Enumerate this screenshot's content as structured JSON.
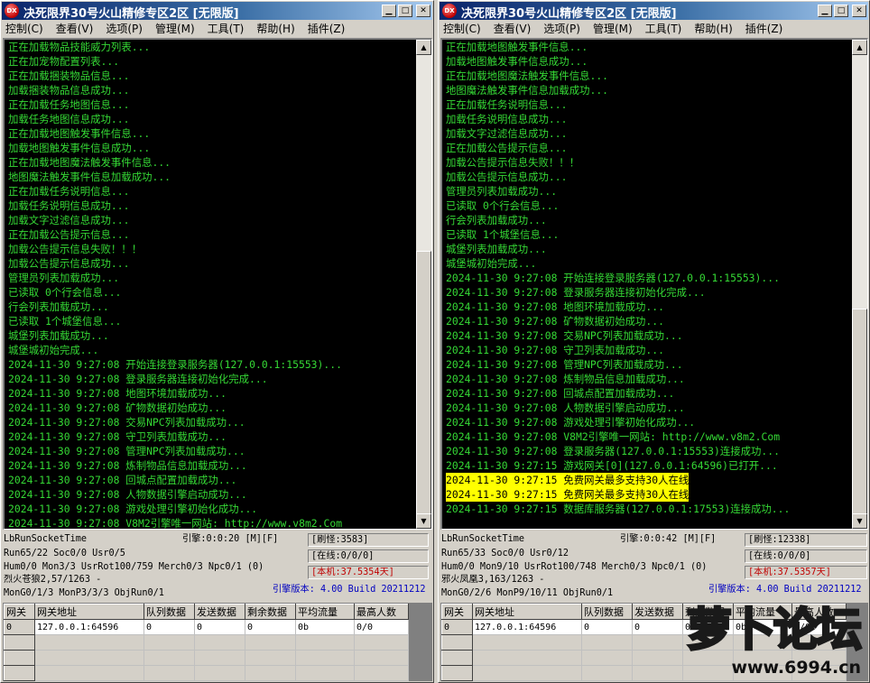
{
  "left": {
    "title": "决死限界30号火山精修专区2区 [无限版]",
    "icon_text": "DX",
    "menu": [
      "控制(C)",
      "查看(V)",
      "选项(P)",
      "管理(M)",
      "工具(T)",
      "帮助(H)",
      "插件(Z)"
    ],
    "log": [
      "正在加载物品技能威力列表...",
      "正在加宠物配置列表...",
      "正在加载捆装物品信息...",
      "加载捆装物品信息成功...",
      "正在加载任务地图信息...",
      "加载任务地图信息成功...",
      "正在加载地图触发事件信息...",
      "加载地图触发事件信息成功...",
      "正在加载地图魔法触发事件信息...",
      "地图魔法触发事件信息加载成功...",
      "正在加载任务说明信息...",
      "加载任务说明信息成功...",
      "加载文字过滤信息成功...",
      "正在加载公告提示信息...",
      "加载公告提示信息失败！！！",
      "加载公告提示信息成功...",
      "管理员列表加载成功...",
      "已读取 0个行会信息...",
      "行会列表加载成功...",
      "已读取 1个城堡信息...",
      "城堡列表加载成功...",
      "城堡城初始完成...",
      "2024-11-30 9:27:08 开始连接登录服务器(127.0.0.1:15553)...",
      "2024-11-30 9:27:08 登录服务器连接初始化完成...",
      "2024-11-30 9:27:08 地图环境加载成功...",
      "2024-11-30 9:27:08 矿物数据初始成功...",
      "2024-11-30 9:27:08 交易NPC列表加载成功...",
      "2024-11-30 9:27:08 守卫列表加载成功...",
      "2024-11-30 9:27:08 管理NPC列表加载成功...",
      "2024-11-30 9:27:08 炼制物品信息加载成功...",
      "2024-11-30 9:27:08 回城点配置加载成功...",
      "2024-11-30 9:27:08 人物数据引擎启动成功...",
      "2024-11-30 9:27:08 游戏处理引擎初始化成功...",
      "2024-11-30 9:27:08 V8M2引擎唯一网站: http://www.v8m2.Com"
    ],
    "status": {
      "run_socket_time": "LbRunSocketTime",
      "engine": "引擎:0:0:20 [M][F]",
      "refresh": "[刷怪:3583]",
      "run": "Run65/22 Soc0/0 Usr0/5",
      "online": "[在线:0/0/0]",
      "hum": "Hum0/0 Mon3/3 UsrRot100/759 Merch0/3 Npc0/1 (0)",
      "local": "[本机:37.5354天]",
      "player": "烈火苍狼2,57/1263 -",
      "mon": "MonG0/1/3 MonP3/3/3 ObjRun0/1",
      "version": "引擎版本: 4.00 Build 20211212"
    },
    "grid": {
      "headers": [
        "网关",
        "网关地址",
        "队列数据",
        "发送数据",
        "剩余数据",
        "平均流量",
        "最高人数"
      ],
      "rows": [
        [
          "0",
          "127.0.0.1:64596",
          "0",
          "0",
          "0",
          "0b",
          "0/0"
        ]
      ]
    }
  },
  "right": {
    "title": "决死限界30号火山精修专区2区 [无限版]",
    "icon_text": "DX",
    "menu": [
      "控制(C)",
      "查看(V)",
      "选项(P)",
      "管理(M)",
      "工具(T)",
      "帮助(H)",
      "插件(Z)"
    ],
    "log": [
      "正在加载地图触发事件信息...",
      "加载地图触发事件信息成功...",
      "正在加载地图魔法触发事件信息...",
      "地图魔法触发事件信息加载成功...",
      "正在加载任务说明信息...",
      "加载任务说明信息成功...",
      "加载文字过滤信息成功...",
      "正在加载公告提示信息...",
      "加载公告提示信息失败！！！",
      "加载公告提示信息成功...",
      "管理员列表加载成功...",
      "已读取 0个行会信息...",
      "行会列表加载成功...",
      "已读取 1个城堡信息...",
      "城堡列表加载成功...",
      "城堡城初始完成...",
      "2024-11-30 9:27:08 开始连接登录服务器(127.0.0.1:15553)...",
      "2024-11-30 9:27:08 登录服务器连接初始化完成...",
      "2024-11-30 9:27:08 地图环境加载成功...",
      "2024-11-30 9:27:08 矿物数据初始成功...",
      "2024-11-30 9:27:08 交易NPC列表加载成功...",
      "2024-11-30 9:27:08 守卫列表加载成功...",
      "2024-11-30 9:27:08 管理NPC列表加载成功...",
      "2024-11-30 9:27:08 炼制物品信息加载成功...",
      "2024-11-30 9:27:08 回城点配置加载成功...",
      "2024-11-30 9:27:08 人物数据引擎启动成功...",
      "2024-11-30 9:27:08 游戏处理引擎初始化成功...",
      "2024-11-30 9:27:08 V8M2引擎唯一网站: http://www.v8m2.Com",
      "2024-11-30 9:27:08 登录服务器(127.0.0.1:15553)连接成功...",
      "2024-11-30 9:27:15 游戏网关[0](127.0.0.1:64596)已打开...",
      "2024-11-30 9:27:15 免费网关最多支持30人在线",
      "2024-11-30 9:27:15 免费网关最多支持30人在线",
      "2024-11-30 9:27:15 数据库服务器(127.0.0.1:17553)连接成功..."
    ],
    "highlight_lines": [
      30,
      31
    ],
    "status": {
      "run_socket_time": "LbRunSocketTime",
      "engine": "引擎:0:0:42 [M][F]",
      "refresh": "[刷怪:12338]",
      "run": "Run65/33 Soc0/0 Usr0/12",
      "online": "[在线:0/0/0]",
      "hum": "Hum0/0 Mon9/10 UsrRot100/748 Merch0/3 Npc0/1 (0)",
      "local": "[本机:37.5357天]",
      "player": "邪火凤凰3,163/1263 -",
      "mon": "MonG0/2/6 MonP9/10/11 ObjRun0/1",
      "version": "引擎版本: 4.00 Build 20211212"
    },
    "grid": {
      "headers": [
        "网关",
        "网关地址",
        "队列数据",
        "发送数据",
        "剩余数据",
        "平均流量",
        "最高人数"
      ],
      "rows": [
        [
          "0",
          "127.0.0.1:64596",
          "0",
          "0",
          "0",
          "0b",
          "0/0"
        ]
      ]
    }
  },
  "watermark": {
    "logo_text": "萝卜论坛",
    "url": "www.6994.cn"
  },
  "colors": {
    "console_text": "#35d935",
    "highlight": "#ffff00",
    "status_red": "#c00000",
    "status_blue": "#0000c0"
  }
}
